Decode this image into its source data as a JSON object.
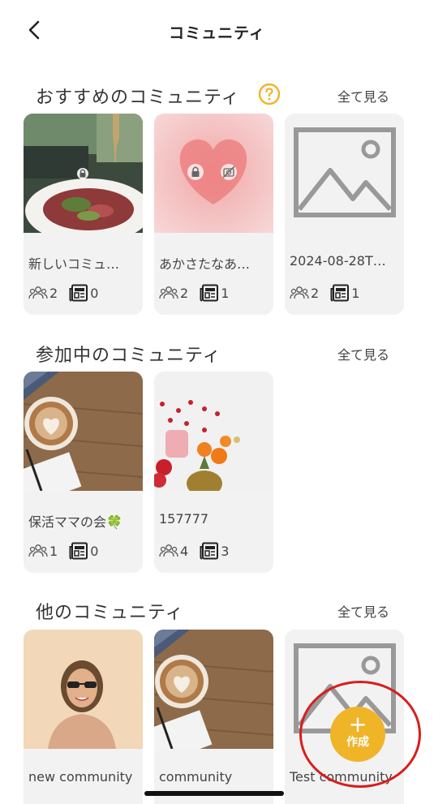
{
  "header": {
    "title": "コミュニティ"
  },
  "sections": [
    {
      "title": "おすすめのコミュニティ",
      "see_all": "全て見る",
      "cards": [
        {
          "name": "新しいコミュ…",
          "members": "2",
          "posts": "0"
        },
        {
          "name": "あかさたなあ…",
          "members": "2",
          "posts": "1"
        },
        {
          "name": "2024-08-28T…",
          "members": "2",
          "posts": "1"
        }
      ]
    },
    {
      "title": "参加中のコミュニティ",
      "see_all": "全て見る",
      "cards": [
        {
          "name": "保活ママの会🍀",
          "members": "1",
          "posts": "0"
        },
        {
          "name": "157777",
          "members": "4",
          "posts": "3"
        }
      ]
    },
    {
      "title": "他のコミュニティ",
      "see_all": "全て見る",
      "cards": [
        {
          "name": "new community"
        },
        {
          "name": "community"
        },
        {
          "name": "Test community"
        }
      ]
    }
  ],
  "fab": {
    "plus": "+",
    "label": "作成"
  },
  "colors": {
    "accent": "#f0b429",
    "card_bg": "#f2f2f2",
    "highlight": "#d81d1d"
  },
  "icons": [
    "chevron-left-icon",
    "help-icon",
    "lock-icon",
    "no-camera-icon",
    "members-icon",
    "posts-icon",
    "image-placeholder-icon"
  ]
}
